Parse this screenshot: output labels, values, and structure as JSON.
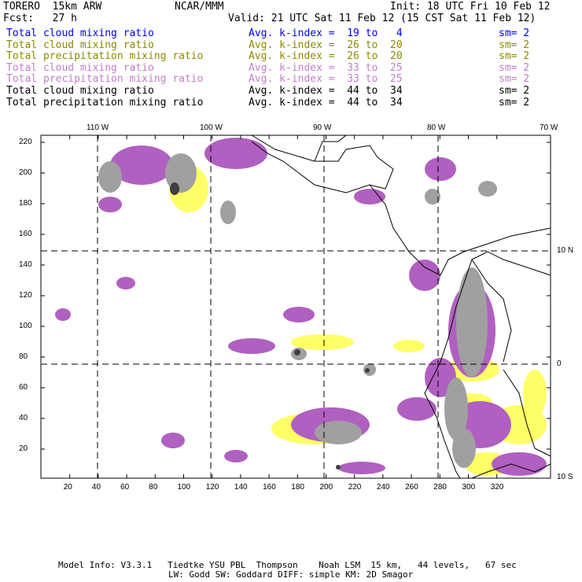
{
  "header": {
    "model": "TORERO  15km ARW",
    "org": "NCAR/MMM",
    "init": "Init: 18 UTC Fri 10 Feb 12",
    "fcst": "Fcst:   27 h",
    "valid": "Valid: 21 UTC Sat 11 Feb 12 (15 CST Sat 11 Feb 12)"
  },
  "legend": [
    {
      "field": "Total cloud mixing ratio",
      "range": "Avg. k-index =  19 to   4",
      "sm": "sm= 2",
      "color": "#0000ff"
    },
    {
      "field": "Total cloud mixing ratio",
      "range": "Avg. k-index =  26 to  20",
      "sm": "sm= 2",
      "color": "#8b8b00"
    },
    {
      "field": "Total precipitation mixing ratio",
      "range": "Avg. k-index =  26 to  20",
      "sm": "sm= 2",
      "color": "#8b8b00"
    },
    {
      "field": "Total cloud mixing ratio",
      "range": "Avg. k-index =  33 to  25",
      "sm": "sm= 2",
      "color": "#c080c8"
    },
    {
      "field": "Total precipitation mixing ratio",
      "range": "Avg. k-index =  33 to  25",
      "sm": "sm= 2",
      "color": "#c080c8"
    },
    {
      "field": "Total cloud mixing ratio",
      "range": "Avg. k-index =  44 to  34",
      "sm": "sm= 2",
      "color": "#000000"
    },
    {
      "field": "Total precipitation mixing ratio",
      "range": "Avg. k-index =  44 to  34",
      "sm": "sm= 2",
      "color": "#000000"
    }
  ],
  "map": {
    "lon_labels": [
      "110 W",
      "100 W",
      "90 W",
      "80 W",
      "70 W"
    ],
    "lat_labels": [
      "10 N",
      "0",
      "10 S"
    ],
    "x_ticks": [
      "20",
      "40",
      "60",
      "80",
      "100",
      "120",
      "140",
      "160",
      "180",
      "200",
      "220",
      "240",
      "260",
      "280",
      "300",
      "320"
    ],
    "y_ticks": [
      "220",
      "200",
      "180",
      "160",
      "140",
      "120",
      "100",
      "80",
      "60",
      "40",
      "20"
    ],
    "colors": {
      "yellow": "#ffff66",
      "purple": "#b060c0",
      "gray": "#a0a0a0",
      "dark": "#404040",
      "cyan": "#c8f0f8"
    }
  },
  "footer": {
    "line1": "Model Info: V3.3.1   Tiedtke YSU PBL  Thompson    Noah LSM  15 km,   44 levels,   67 sec",
    "line2": "LW: Godd SW: Goddard DIFF: simple KM: 2D Smagor"
  }
}
